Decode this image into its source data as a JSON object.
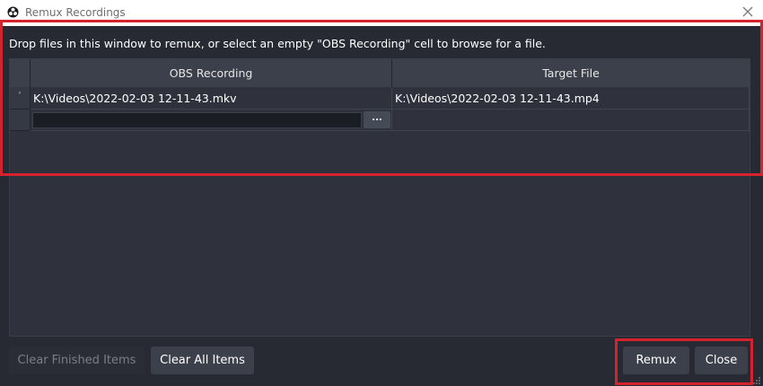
{
  "window": {
    "title": "Remux Recordings",
    "icon": "obs-logo-icon"
  },
  "instruction": "Drop files in this window to remux, or select an empty \"OBS Recording\" cell to browse for a file.",
  "table": {
    "columns": [
      "OBS Recording",
      "Target File"
    ],
    "rows": [
      {
        "status": "'",
        "source": "K:\\Videos\\2022-02-03 12-11-43.mkv",
        "target": "K:\\Videos\\2022-02-03 12-11-43.mp4"
      }
    ],
    "edit_row": {
      "source_value": "",
      "browse_label": "..."
    }
  },
  "buttons": {
    "clear_finished": "Clear Finished Items",
    "clear_all": "Clear All Items",
    "remux": "Remux",
    "close": "Close"
  },
  "colors": {
    "background": "#272a33",
    "highlight": "#d4232d",
    "button": "#3c404b"
  }
}
